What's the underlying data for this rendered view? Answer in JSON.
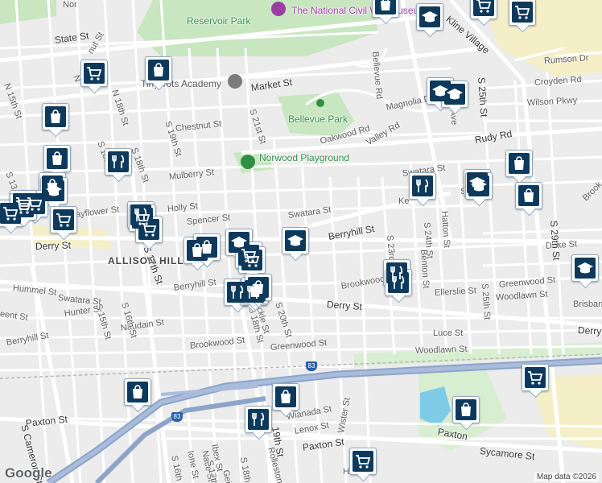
{
  "map": {
    "attribution": "Map data ©2026",
    "logo": "Google",
    "colors": {
      "background": "#ececec",
      "road": "#ffffff",
      "highway": "#8da4c9",
      "park": "#c8e6c0",
      "water": "#7ecbe8",
      "marker_bg": "#0d3a5c",
      "district": "#f5efc8"
    },
    "labels": [
      {
        "id": "reservoir-park",
        "text": "Reservoir Park",
        "cls": "park"
      },
      {
        "id": "museum",
        "text": "The National Civil War Museum",
        "cls": "museum"
      },
      {
        "id": "state-st",
        "text": "State St",
        "cls": "big"
      },
      {
        "id": "market-st",
        "text": "Market St",
        "cls": "big"
      },
      {
        "id": "rumson-dr",
        "text": "Rumson Dr",
        "cls": ""
      },
      {
        "id": "croyden-rd",
        "text": "Croyden Rd",
        "cls": ""
      },
      {
        "id": "wilson-pkwy",
        "text": "Wilson Pkwy",
        "cls": ""
      },
      {
        "id": "academy",
        "text": "Tiny Tots Academy",
        "cls": "poi"
      },
      {
        "id": "bellevue-park",
        "text": "Bellevue Park",
        "cls": "park"
      },
      {
        "id": "chestnut-st",
        "text": "Chestnut St",
        "cls": ""
      },
      {
        "id": "oakwood-rd",
        "text": "Oakwood Rd",
        "cls": ""
      },
      {
        "id": "valley-rd",
        "text": "Valley Rd",
        "cls": ""
      },
      {
        "id": "magnolia-dr",
        "text": "Magnolia Dr",
        "cls": ""
      },
      {
        "id": "rudy-rd",
        "text": "Rudy Rd",
        "cls": "big"
      },
      {
        "id": "norwood",
        "text": "Norwood Playground",
        "cls": "park"
      },
      {
        "id": "mulberry-st",
        "text": "Mulberry St",
        "cls": ""
      },
      {
        "id": "holly-st",
        "text": "Holly St",
        "cls": ""
      },
      {
        "id": "spencer-st",
        "text": "Spencer St",
        "cls": ""
      },
      {
        "id": "swatara-st-1",
        "text": "Swatara St",
        "cls": ""
      },
      {
        "id": "swatara-st-2",
        "text": "Swatara St",
        "cls": ""
      },
      {
        "id": "mayflower-st",
        "text": "Mayflower St",
        "cls": ""
      },
      {
        "id": "derry-st-1",
        "text": "Derry St",
        "cls": "big"
      },
      {
        "id": "allison-hill",
        "text": "ALLISON HILL",
        "cls": "dist"
      },
      {
        "id": "berryhill-st-1",
        "text": "Berryhill St",
        "cls": "big"
      },
      {
        "id": "berryhill-st-2",
        "text": "Berryhill St",
        "cls": ""
      },
      {
        "id": "berryhill-st-3",
        "text": "Berryhill St",
        "cls": ""
      },
      {
        "id": "duke-st",
        "text": "Duke St",
        "cls": ""
      },
      {
        "id": "greenwood-st-1",
        "text": "Greenwood St",
        "cls": ""
      },
      {
        "id": "greenwood-st-2",
        "text": "Greenwood St",
        "cls": ""
      },
      {
        "id": "ellerslie-st",
        "text": "Ellerslie St",
        "cls": ""
      },
      {
        "id": "woodlawn-st-1",
        "text": "Woodlawn St",
        "cls": ""
      },
      {
        "id": "woodlawn-st-2",
        "text": "Woodlawn St",
        "cls": ""
      },
      {
        "id": "brisban",
        "text": "Brisban",
        "cls": ""
      },
      {
        "id": "derry-st-2",
        "text": "Derry St",
        "cls": "big"
      },
      {
        "id": "derry-st-3",
        "text": "Derry",
        "cls": "big"
      },
      {
        "id": "luce-st",
        "text": "Luce St",
        "cls": ""
      },
      {
        "id": "brookwood-st-1",
        "text": "Brookwood St",
        "cls": ""
      },
      {
        "id": "brookwood-st-2",
        "text": "Brookwood",
        "cls": ""
      },
      {
        "id": "hummel-st",
        "text": "Hummel St",
        "cls": ""
      },
      {
        "id": "swatara-st-3",
        "text": "Swatara St",
        "cls": ""
      },
      {
        "id": "hunter-st",
        "text": "Hunter St",
        "cls": ""
      },
      {
        "id": "naudain-st",
        "text": "Naudain St",
        "cls": ""
      },
      {
        "id": "paxton-st-1",
        "text": "Paxton St",
        "cls": "big"
      },
      {
        "id": "paxton-st-2",
        "text": "Paxton St",
        "cls": "big"
      },
      {
        "id": "paxton-st-3",
        "text": "Paxton",
        "cls": "big"
      },
      {
        "id": "sycamore-st",
        "text": "Sycamore St",
        "cls": "big"
      },
      {
        "id": "lenox-st",
        "text": "Lenox St",
        "cls": ""
      },
      {
        "id": "wianada-st",
        "text": "Wianada St",
        "cls": ""
      },
      {
        "id": "wister-st",
        "text": "Wister St",
        "cls": ""
      },
      {
        "id": "s-cameron-st",
        "text": "S Cameron St",
        "cls": "big"
      },
      {
        "id": "s-17th-st",
        "text": "S 17th St",
        "cls": "big"
      },
      {
        "id": "s-19th-st-a",
        "text": "S 19th St",
        "cls": ""
      },
      {
        "id": "s-18th-st-a",
        "text": "S 18th St",
        "cls": ""
      },
      {
        "id": "s-21st-st",
        "text": "S 21st St",
        "cls": ""
      },
      {
        "id": "s-20th-st",
        "text": "S 20th St",
        "cls": ""
      },
      {
        "id": "s-16th-st",
        "text": "S 16th St",
        "cls": ""
      },
      {
        "id": "s-15th-st",
        "text": "S 15th St",
        "cls": ""
      },
      {
        "id": "n-15th-st",
        "text": "N 15th St",
        "cls": ""
      },
      {
        "id": "n-18th-st",
        "text": "N 18th St",
        "cls": ""
      },
      {
        "id": "s-23rd",
        "text": "S 23rd",
        "cls": ""
      },
      {
        "id": "s-24th-st",
        "text": "S 24th St",
        "cls": ""
      },
      {
        "id": "s-25th-st-1",
        "text": "S 25th St",
        "cls": "big"
      },
      {
        "id": "s-25th-st-2",
        "text": "S 25th St",
        "cls": ""
      },
      {
        "id": "s-29th-st",
        "text": "S 29th St",
        "cls": "big"
      },
      {
        "id": "hatton-st",
        "text": "Hatton St",
        "cls": ""
      },
      {
        "id": "benton-st",
        "text": "Benton St",
        "cls": ""
      },
      {
        "id": "kline-village",
        "text": "Kline Village",
        "cls": "big"
      },
      {
        "id": "bellevue-rd",
        "text": "Bellevue Rd",
        "cls": ""
      },
      {
        "id": "ave",
        "text": "e Ave",
        "cls": ""
      },
      {
        "id": "kensington",
        "text": "Ke",
        "cls": ""
      },
      {
        "id": "hatton-short",
        "text": "St",
        "cls": ""
      },
      {
        "id": "rollestone",
        "text": "Rollestone",
        "cls": ""
      },
      {
        "id": "ione-st",
        "text": "Ione St",
        "cls": ""
      },
      {
        "id": "nace-st",
        "text": "Nace St",
        "cls": ""
      },
      {
        "id": "ibex-st",
        "text": "Ibex St",
        "cls": ""
      },
      {
        "id": "s-17th-st-b",
        "text": "S 17th St",
        "cls": ""
      },
      {
        "id": "s-16th-st-b",
        "text": "S 16th St",
        "cls": ""
      },
      {
        "id": "s-18th-st-b",
        "text": "S 18th St",
        "cls": ""
      },
      {
        "id": "s-19th-st-b",
        "text": "19th St",
        "cls": "big"
      },
      {
        "id": "geiz",
        "text": "Geiz",
        "cls": ""
      },
      {
        "id": "nut-st",
        "text": "nut St",
        "cls": ""
      },
      {
        "id": "n-st",
        "text": "N",
        "cls": ""
      },
      {
        "id": "brook",
        "text": "Brook",
        "cls": ""
      },
      {
        "id": "s-18th-st-c",
        "text": "S 18th St",
        "cls": ""
      },
      {
        "id": "s-13",
        "text": "S 13",
        "cls": ""
      },
      {
        "id": "s-15-st",
        "text": "St",
        "cls": ""
      },
      {
        "id": "eent-st",
        "text": "eent St",
        "cls": ""
      },
      {
        "id": "ckle-st",
        "text": "ckle St",
        "cls": ""
      },
      {
        "id": "hu",
        "text": "Hu",
        "cls": ""
      },
      {
        "id": "nor",
        "text": "Nor",
        "cls": ""
      },
      {
        "id": "s-18th-st-d",
        "text": "S 18th St",
        "cls": ""
      }
    ],
    "markers": [
      {
        "id": "m1",
        "type": "shopping"
      },
      {
        "id": "m2",
        "type": "school"
      },
      {
        "id": "m3",
        "type": "cart"
      },
      {
        "id": "m4",
        "type": "cart"
      },
      {
        "id": "m5",
        "type": "shopping"
      },
      {
        "id": "m6",
        "type": "cart"
      },
      {
        "id": "m7",
        "type": "school"
      },
      {
        "id": "m8",
        "type": "school"
      },
      {
        "id": "m9",
        "type": "shopping"
      },
      {
        "id": "m10",
        "type": "shopping"
      },
      {
        "id": "m11",
        "type": "restaurant"
      },
      {
        "id": "m12",
        "type": "shopping"
      },
      {
        "id": "m13",
        "type": "school"
      },
      {
        "id": "m14",
        "type": "cart"
      },
      {
        "id": "m15",
        "type": "cart"
      },
      {
        "id": "m16",
        "type": "cart"
      },
      {
        "id": "m17",
        "type": "restaurant"
      },
      {
        "id": "m18",
        "type": "cart"
      },
      {
        "id": "m19",
        "type": "cart"
      },
      {
        "id": "m20",
        "type": "school"
      },
      {
        "id": "m21",
        "type": "shopping"
      },
      {
        "id": "m22",
        "type": "shopping"
      },
      {
        "id": "m23",
        "type": "restaurant"
      },
      {
        "id": "m24",
        "type": "restaurant"
      },
      {
        "id": "m25",
        "type": "school"
      },
      {
        "id": "m26",
        "type": "shopping"
      },
      {
        "id": "m27",
        "type": "school"
      },
      {
        "id": "m28",
        "type": "shopping"
      },
      {
        "id": "m29",
        "type": "school"
      },
      {
        "id": "m30",
        "type": "cart"
      },
      {
        "id": "m31",
        "type": "cart"
      },
      {
        "id": "m32",
        "type": "shopping"
      },
      {
        "id": "m33",
        "type": "shopping"
      },
      {
        "id": "m34",
        "type": "restaurant"
      },
      {
        "id": "m35",
        "type": "restaurant"
      },
      {
        "id": "m36",
        "type": "restaurant"
      },
      {
        "id": "m37",
        "type": "school"
      },
      {
        "id": "m38",
        "type": "cart"
      },
      {
        "id": "m39",
        "type": "shopping"
      },
      {
        "id": "m40",
        "type": "cart"
      },
      {
        "id": "m41",
        "type": "shopping"
      },
      {
        "id": "m42",
        "type": "shopping"
      },
      {
        "id": "m43",
        "type": "restaurant"
      },
      {
        "id": "m44",
        "type": "cart"
      },
      {
        "id": "m45",
        "type": "cart"
      }
    ],
    "highway_shields": [
      "83",
      "83"
    ]
  }
}
